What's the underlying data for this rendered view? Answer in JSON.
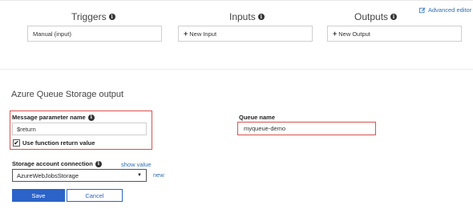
{
  "header": {
    "advanced_editor": "Advanced editor",
    "triggers": "Triggers",
    "inputs": "Inputs",
    "outputs": "Outputs",
    "trigger_value": "Manual (input)",
    "new_input": "New Input",
    "new_output": "New Output"
  },
  "section": {
    "title": "Azure Queue Storage output"
  },
  "form": {
    "message_param_label": "Message parameter name",
    "message_param_value": "$return",
    "use_return_label": "Use function return value",
    "use_return_checked": true,
    "queue_name_label": "Queue name",
    "queue_name_value": "myqueue-demo",
    "storage_label": "Storage account connection",
    "show_value": "show value",
    "storage_value": "AzureWebJobsStorage",
    "new_link": "new",
    "save": "Save",
    "cancel": "Cancel"
  },
  "colors": {
    "accent": "#2b63c9",
    "highlight": "#d9534f"
  }
}
